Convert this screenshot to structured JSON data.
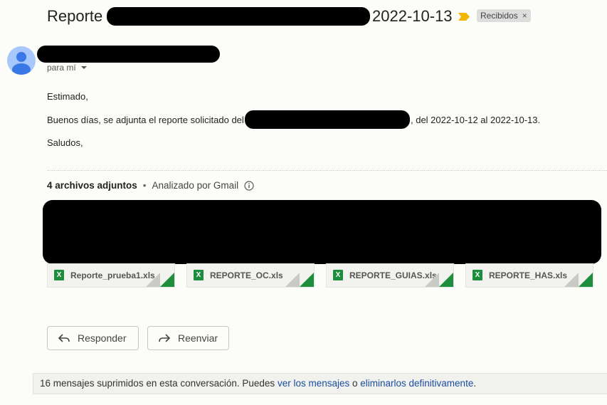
{
  "subject": {
    "title": "Reporte",
    "date": "2022-10-13",
    "label": "Recibidos",
    "label_remove": "×"
  },
  "sender": {
    "to_text": "para mí"
  },
  "body": {
    "greeting": "Estimado,",
    "line_before": "Buenos días, se adjunta el reporte solicitado del",
    "line_after": ", del 2022-10-12 al 2022-10-13.",
    "closing": "Saludos,"
  },
  "attachments": {
    "count_text": "4 archivos adjuntos",
    "separator": "•",
    "scan_text": "Analizado por Gmail",
    "files": [
      {
        "name": "Reporte_prueba1.xls",
        "icon": "X"
      },
      {
        "name": "REPORTE_OC.xls",
        "icon": "X"
      },
      {
        "name": "REPORTE_GUIAS.xls",
        "icon": "X"
      },
      {
        "name": "REPORTE_HAS.xls",
        "icon": "X"
      }
    ]
  },
  "actions": {
    "reply": "Responder",
    "forward": "Reenviar"
  },
  "footer": {
    "text_before": "16 mensajes suprimidos en esta conversación. Puedes ",
    "link_view": "ver los mensajes",
    "text_mid": " o ",
    "link_delete": "eliminarlos definitivamente",
    "text_end": "."
  },
  "colors": {
    "importance": "#f2b600",
    "xls_green": "#1e8e3e",
    "link": "#1a4fa0",
    "avatar": "#a8c7fa"
  }
}
